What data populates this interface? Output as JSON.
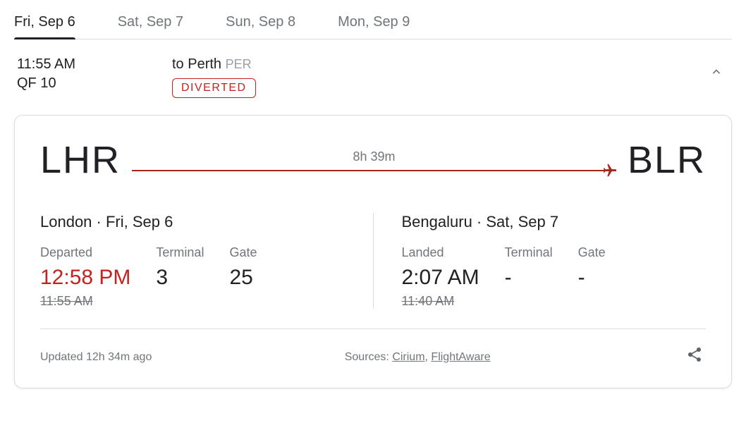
{
  "tabs": [
    {
      "label": "Fri, Sep 6",
      "active": true
    },
    {
      "label": "Sat, Sep 7",
      "active": false
    },
    {
      "label": "Sun, Sep 8",
      "active": false
    },
    {
      "label": "Mon, Sep 9",
      "active": false
    }
  ],
  "flight": {
    "scheduled_time": "11:55 AM",
    "number": "QF 10",
    "destination": "to Perth",
    "destination_code": "PER",
    "status": "DIVERTED"
  },
  "route": {
    "from_code": "LHR",
    "to_code": "BLR",
    "duration": "8h 39m"
  },
  "departure": {
    "loc_date": "London · Fri, Sep 6",
    "status_label": "Departed",
    "actual_time": "12:58 PM",
    "original_time": "11:55 AM",
    "terminal_label": "Terminal",
    "terminal": "3",
    "gate_label": "Gate",
    "gate": "25"
  },
  "arrival": {
    "loc_date": "Bengaluru · Sat, Sep 7",
    "status_label": "Landed",
    "actual_time": "2:07 AM",
    "original_time": "11:40 AM",
    "terminal_label": "Terminal",
    "terminal": "-",
    "gate_label": "Gate",
    "gate": "-"
  },
  "footer": {
    "updated": "Updated 12h 34m ago",
    "sources_label": "Sources:",
    "source1": "Cirium",
    "source2": "FlightAware"
  }
}
